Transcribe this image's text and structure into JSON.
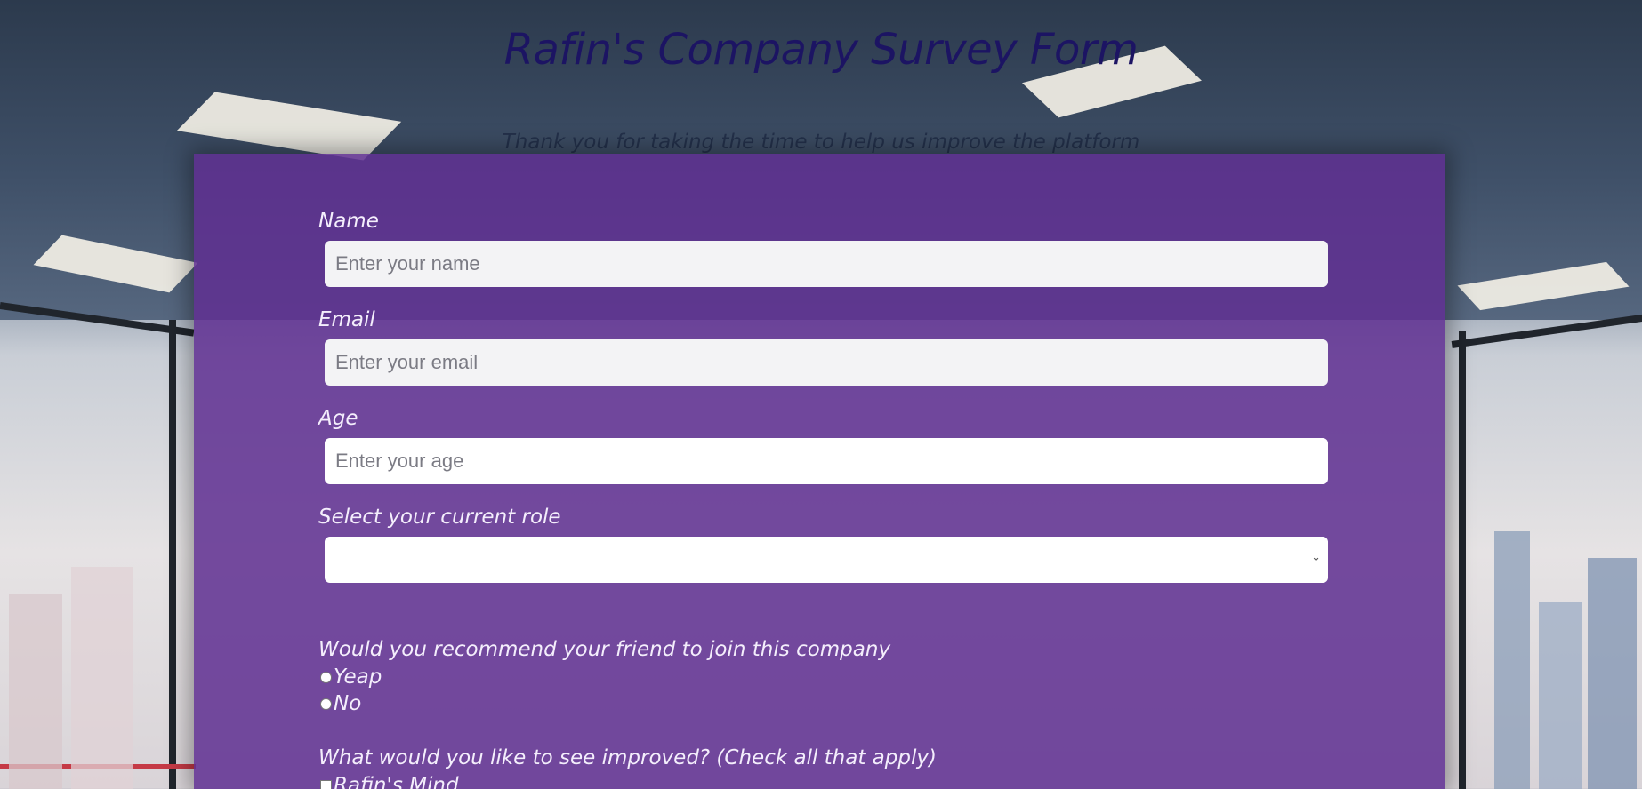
{
  "header": {
    "title": "Rafin's Company Survey Form",
    "description": "Thank you for taking the time to help us improve the platform"
  },
  "form": {
    "name": {
      "label": "Name",
      "placeholder": "Enter your name"
    },
    "email": {
      "label": "Email",
      "placeholder": "Enter your email"
    },
    "age": {
      "label": "Age",
      "placeholder": "Enter your age"
    },
    "role": {
      "label": "Select your current role",
      "selected": ""
    },
    "recommend": {
      "question": "Would you recommend your friend to join this company",
      "options": [
        "Yeap",
        "No"
      ]
    },
    "improve": {
      "question": "What would you like to see improved? (Check all that apply)",
      "options": [
        "Rafin's Mind"
      ]
    }
  },
  "colors": {
    "title": "#1c1463",
    "panel": "#603092",
    "label": "#f4eefc"
  },
  "icons": {
    "select_arrow": "chevron-down-icon"
  }
}
